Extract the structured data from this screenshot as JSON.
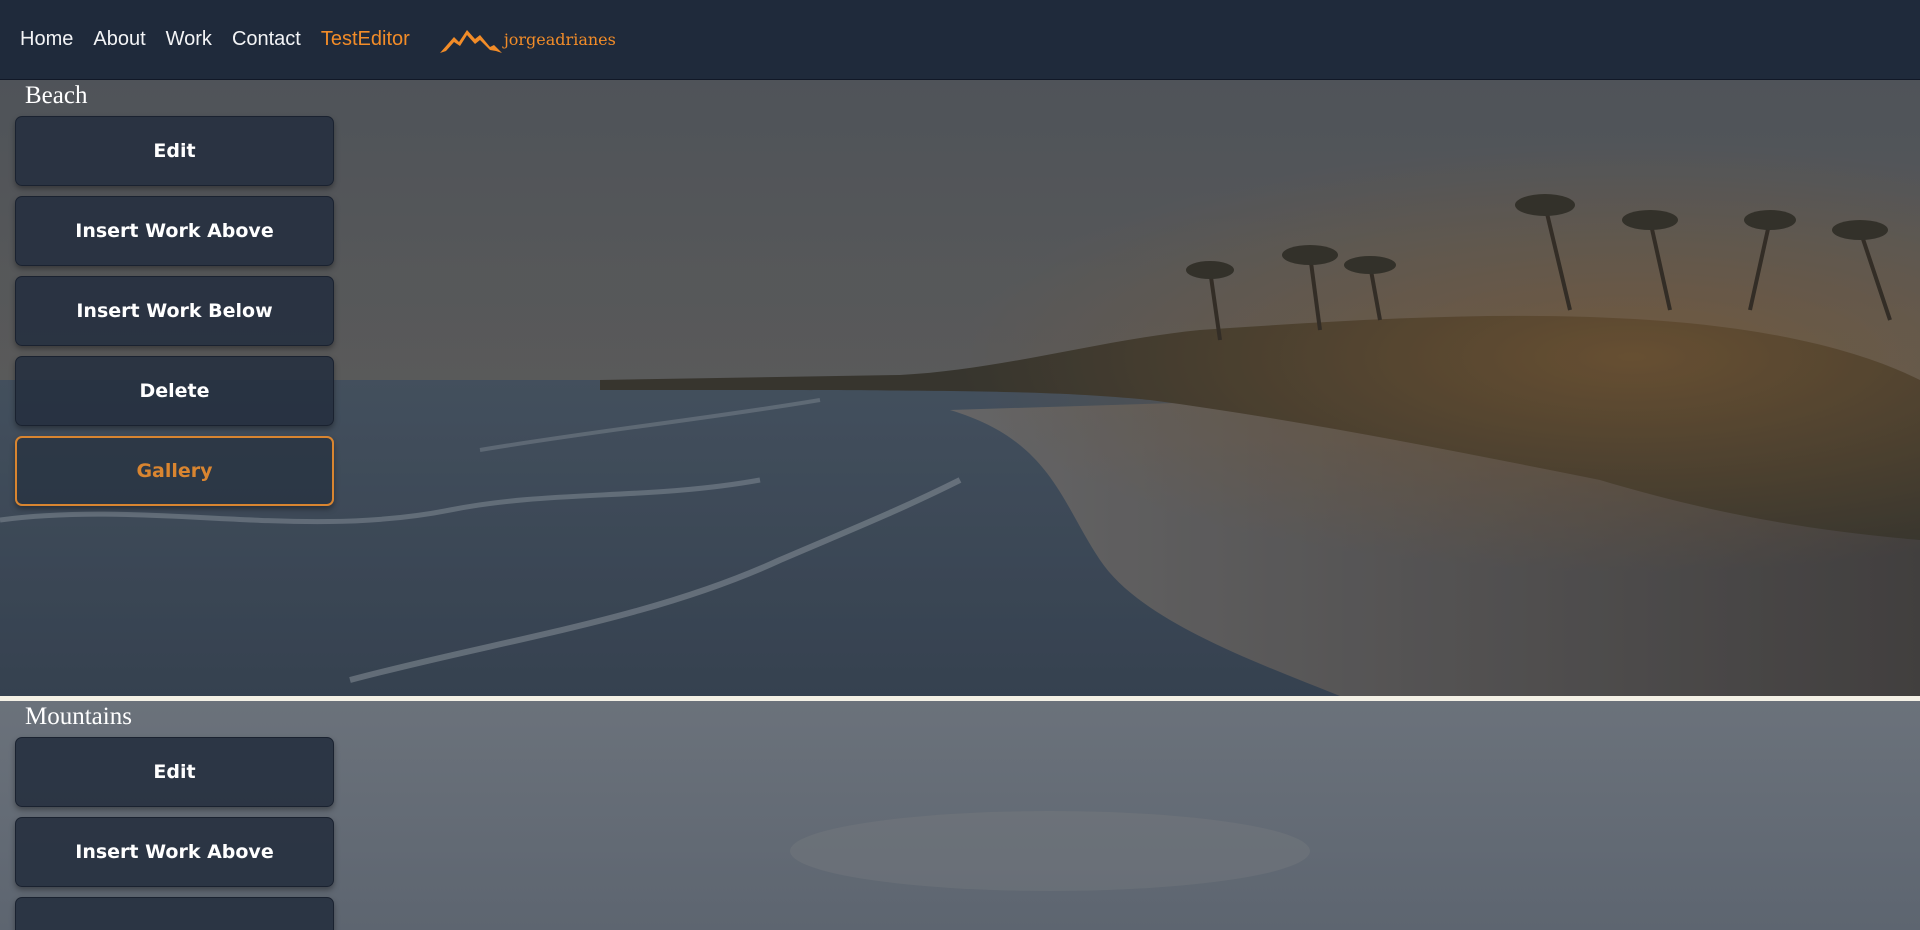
{
  "nav": {
    "links": [
      "Home",
      "About",
      "Work",
      "Contact",
      "TestEditor"
    ],
    "active": "TestEditor",
    "logo_text": "jorgeadrianes"
  },
  "works": [
    {
      "title": "Beach",
      "buttons": {
        "edit": "Edit",
        "insert_above": "Insert Work Above",
        "insert_below": "Insert Work Below",
        "delete": "Delete",
        "gallery": "Gallery"
      }
    },
    {
      "title": "Mountains",
      "buttons": {
        "edit": "Edit",
        "insert_above": "Insert Work Above"
      }
    }
  ],
  "colors": {
    "navbar": "#1f2a3b",
    "accent": "#f28c28",
    "button_bg": "#26303f"
  },
  "icons": [
    "mountain-logo-icon"
  ]
}
